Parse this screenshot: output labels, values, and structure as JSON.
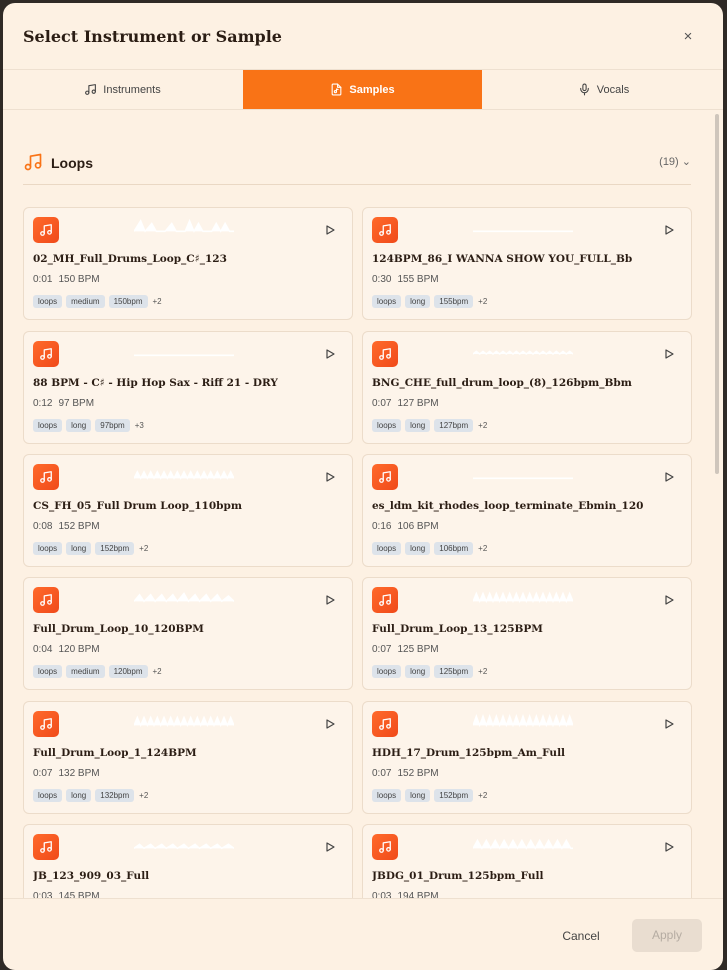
{
  "dialog": {
    "title": "Select Instrument or Sample",
    "close_label": "×"
  },
  "tabs": [
    {
      "label": "Instruments",
      "icon": "music-note-icon",
      "active": false
    },
    {
      "label": "Samples",
      "icon": "audio-file-icon",
      "active": true
    },
    {
      "label": "Vocals",
      "icon": "microphone-icon",
      "active": false
    }
  ],
  "section": {
    "title": "Loops",
    "count": "(19)",
    "icon": "music-note-icon"
  },
  "samples": [
    {
      "name": "02_MH_Full_Drums_Loop_C♯_123",
      "duration": "0:01",
      "bpm": "150 BPM",
      "tags": [
        "loops",
        "medium",
        "150bpm"
      ],
      "more": "+2"
    },
    {
      "name": "124BPM_86_I WANNA SHOW YOU_FULL_Bb",
      "duration": "0:30",
      "bpm": "155 BPM",
      "tags": [
        "loops",
        "long",
        "155bpm"
      ],
      "more": "+2"
    },
    {
      "name": "88 BPM - C♯ - Hip Hop Sax - Riff 21 - DRY",
      "duration": "0:12",
      "bpm": "97 BPM",
      "tags": [
        "loops",
        "long",
        "97bpm"
      ],
      "more": "+3"
    },
    {
      "name": "BNG_CHE_full_drum_loop_(8)_126bpm_Bbm",
      "duration": "0:07",
      "bpm": "127 BPM",
      "tags": [
        "loops",
        "long",
        "127bpm"
      ],
      "more": "+2"
    },
    {
      "name": "CS_FH_05_Full Drum Loop_110bpm",
      "duration": "0:08",
      "bpm": "152 BPM",
      "tags": [
        "loops",
        "long",
        "152bpm"
      ],
      "more": "+2"
    },
    {
      "name": "es_ldm_kit_rhodes_loop_terminate_Ebmin_120",
      "duration": "0:16",
      "bpm": "106 BPM",
      "tags": [
        "loops",
        "long",
        "106bpm"
      ],
      "more": "+2"
    },
    {
      "name": "Full_Drum_Loop_10_120BPM",
      "duration": "0:04",
      "bpm": "120 BPM",
      "tags": [
        "loops",
        "medium",
        "120bpm"
      ],
      "more": "+2"
    },
    {
      "name": "Full_Drum_Loop_13_125BPM",
      "duration": "0:07",
      "bpm": "125 BPM",
      "tags": [
        "loops",
        "long",
        "125bpm"
      ],
      "more": "+2"
    },
    {
      "name": "Full_Drum_Loop_1_124BPM",
      "duration": "0:07",
      "bpm": "132 BPM",
      "tags": [
        "loops",
        "long",
        "132bpm"
      ],
      "more": "+2"
    },
    {
      "name": "HDH_17_Drum_125bpm_Am_Full",
      "duration": "0:07",
      "bpm": "152 BPM",
      "tags": [
        "loops",
        "long",
        "152bpm"
      ],
      "more": "+2"
    },
    {
      "name": "JB_123_909_03_Full",
      "duration": "0:03",
      "bpm": "145 BPM",
      "tags": [],
      "more": ""
    },
    {
      "name": "JBDG_01_Drum_125bpm_Full",
      "duration": "0:03",
      "bpm": "194 BPM",
      "tags": [],
      "more": ""
    }
  ],
  "footer": {
    "cancel_label": "Cancel",
    "apply_label": "Apply"
  },
  "colors": {
    "accent": "#f97316",
    "background": "#fdf1e3",
    "card": "#fdf4ea",
    "tag": "#dde3ea"
  }
}
